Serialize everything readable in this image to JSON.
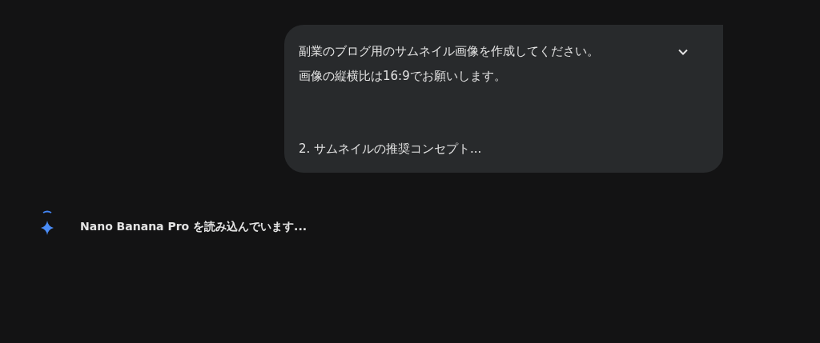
{
  "user_message": {
    "lines": [
      "副業のブログ用のサムネイル画像を作成してください。",
      "画像の縦横比は16:9でお願いします。"
    ],
    "truncated_line": "2. サムネイルの推奨コンセプト..."
  },
  "status": {
    "text": "Nano Banana Pro を読み込んでいます..."
  }
}
